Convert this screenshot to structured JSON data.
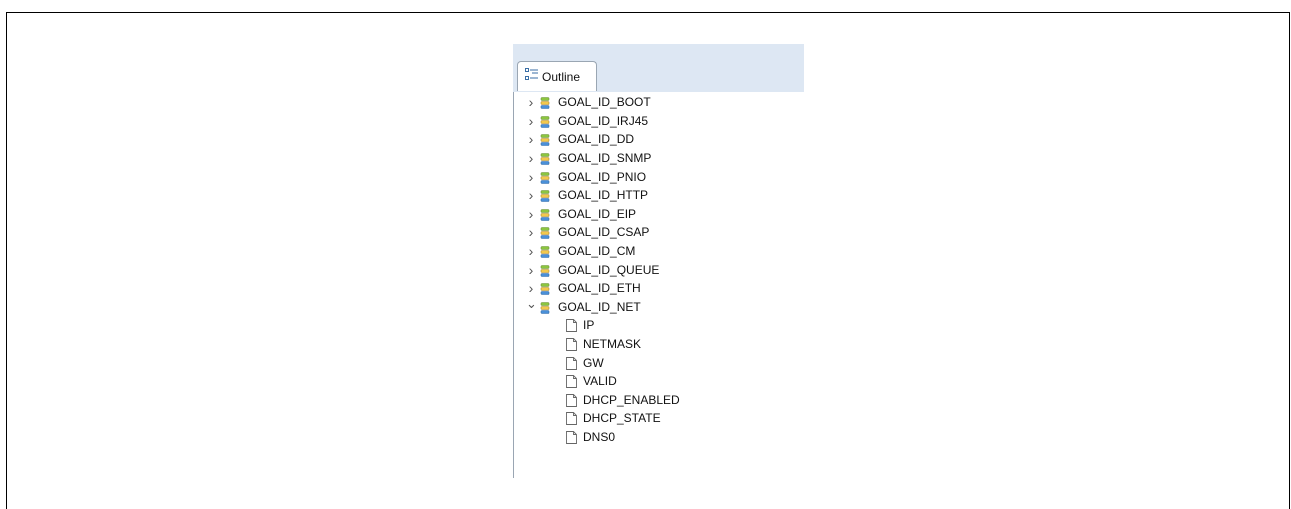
{
  "outline": {
    "tab_label": "Outline",
    "tab_icon": "outline-icon",
    "groups": [
      {
        "label": "GOAL_ID_BOOT",
        "expanded": false
      },
      {
        "label": "GOAL_ID_IRJ45",
        "expanded": false
      },
      {
        "label": "GOAL_ID_DD",
        "expanded": false
      },
      {
        "label": "GOAL_ID_SNMP",
        "expanded": false
      },
      {
        "label": "GOAL_ID_PNIO",
        "expanded": false
      },
      {
        "label": "GOAL_ID_HTTP",
        "expanded": false
      },
      {
        "label": "GOAL_ID_EIP",
        "expanded": false
      },
      {
        "label": "GOAL_ID_CSAP",
        "expanded": false
      },
      {
        "label": "GOAL_ID_CM",
        "expanded": false
      },
      {
        "label": "GOAL_ID_QUEUE",
        "expanded": false
      },
      {
        "label": "GOAL_ID_ETH",
        "expanded": false
      },
      {
        "label": "GOAL_ID_NET",
        "expanded": true
      }
    ],
    "net_children": [
      "IP",
      "NETMASK",
      "GW",
      "VALID",
      "DHCP_ENABLED",
      "DHCP_STATE",
      "DNS0"
    ]
  },
  "colors": {
    "tab_bar": "#dde7f3",
    "db_icon_green": "#8cc63f",
    "db_icon_yellow": "#f2c94c",
    "db_icon_blue": "#4a90d9"
  }
}
